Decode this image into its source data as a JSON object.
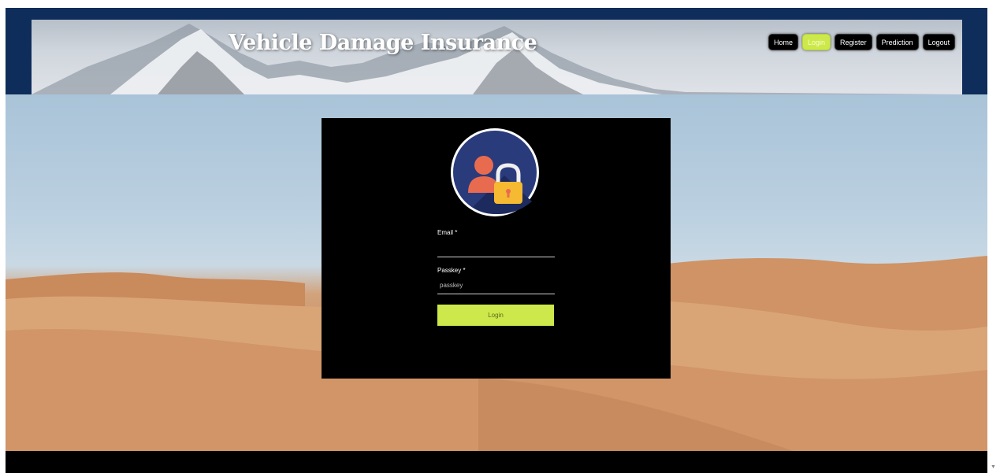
{
  "site": {
    "title": "Vehicle Damage Insurance"
  },
  "nav": {
    "items": [
      {
        "label": "Home",
        "active": false
      },
      {
        "label": "Login",
        "active": true
      },
      {
        "label": "Register",
        "active": false
      },
      {
        "label": "Prediction",
        "active": false
      },
      {
        "label": "Logout",
        "active": false
      }
    ]
  },
  "login_form": {
    "email_label": "Email *",
    "email_value": "",
    "passkey_label": "Passkey *",
    "passkey_placeholder": "passkey",
    "submit_label": "Login"
  },
  "colors": {
    "header_band": "#0e2d5a",
    "accent": "#cde84a",
    "card_bg": "#000000",
    "avatar_circle": "#2a3b7c"
  },
  "icons": {
    "avatar": "user-lock-icon",
    "scroll": "chevron-down-icon"
  }
}
